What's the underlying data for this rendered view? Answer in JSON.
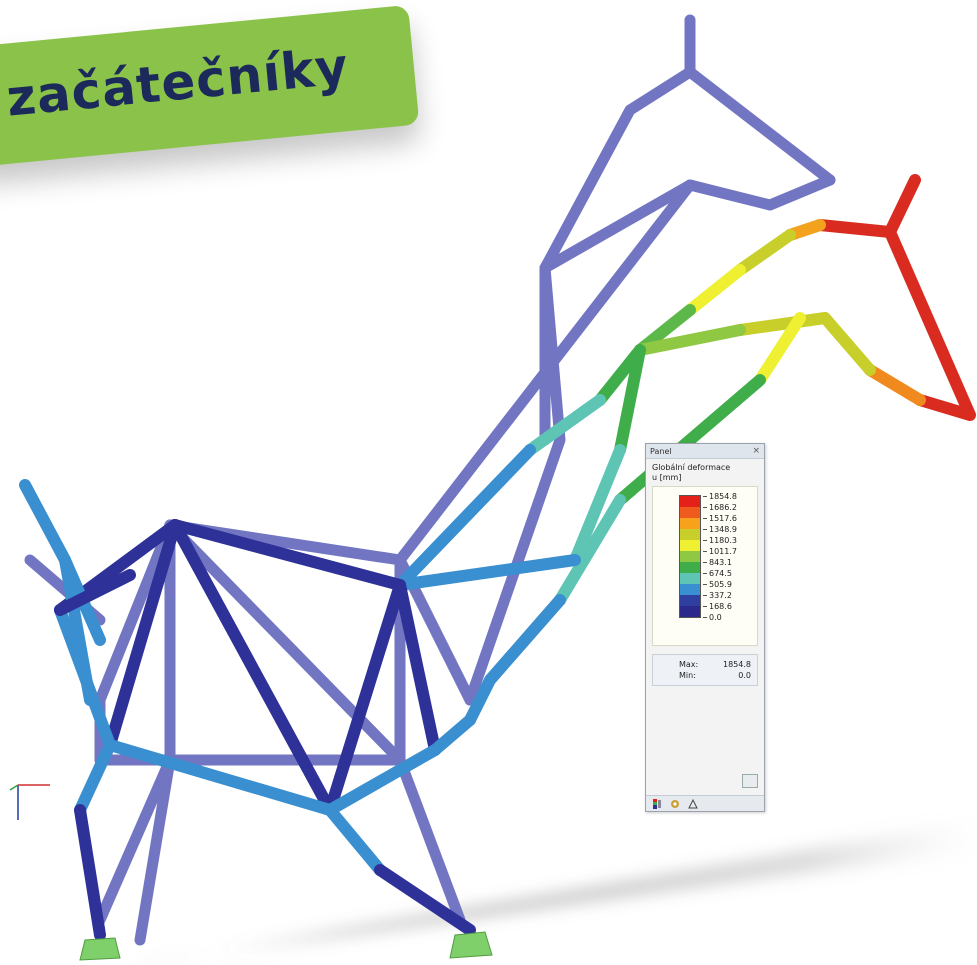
{
  "banner": {
    "text": "začátečníky"
  },
  "panel": {
    "title": "Panel",
    "close": "×",
    "legend_title": "Globální deformace",
    "legend_unit": "u [mm]",
    "legend": [
      {
        "value": "1854.8",
        "color": "#e32119"
      },
      {
        "value": "1686.2",
        "color": "#ef5a1e"
      },
      {
        "value": "1517.6",
        "color": "#f7a21b"
      },
      {
        "value": "1348.9",
        "color": "#c9cf2a"
      },
      {
        "value": "1180.3",
        "color": "#eef031"
      },
      {
        "value": "1011.7",
        "color": "#8fc843"
      },
      {
        "value": "843.1",
        "color": "#3fae4a"
      },
      {
        "value": "674.5",
        "color": "#5ec5b5"
      },
      {
        "value": "505.9",
        "color": "#3a8fd0"
      },
      {
        "value": "337.2",
        "color": "#2e3fa0"
      },
      {
        "value": "168.6",
        "color": "#2b2a8a"
      },
      {
        "value": "0.0",
        "color": ""
      }
    ],
    "max_label": "Max:",
    "max_value": "1854.8",
    "min_label": "Min:",
    "min_value": "0.0"
  },
  "colors": {
    "undeformed": "#6b6fbf",
    "support": "#7fd06a",
    "shadow": "#8a8a8a"
  }
}
